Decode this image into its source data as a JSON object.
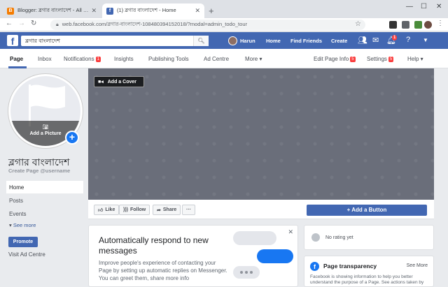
{
  "browser": {
    "tabs": [
      {
        "title": "Blogger: ব্লগার বাংলাদেশ - All po",
        "favicon_color": "#f57c00",
        "favicon_glyph": "B"
      },
      {
        "title": "(1) ব্লগার বাংলাদেশ - Home",
        "favicon_color": "#4267b2",
        "favicon_glyph": "f"
      }
    ],
    "new_tab": "+",
    "url": "web.facebook.com/ব্লগার-বাংলাদেশ-108480394152018/?modal=admin_todo_tour"
  },
  "fb_header": {
    "search_value": "ব্লগার বাংলাদেশ",
    "user": "Harun",
    "nav": [
      "Home",
      "Find Friends",
      "Create"
    ],
    "notification_count": "1"
  },
  "page_nav": {
    "left": [
      {
        "label": "Page"
      },
      {
        "label": "Inbox"
      },
      {
        "label": "Notifications",
        "badge": "1"
      },
      {
        "label": "Insights"
      },
      {
        "label": "Publishing Tools"
      },
      {
        "label": "Ad Centre"
      },
      {
        "label": "More ▾"
      }
    ],
    "right": [
      {
        "label": "Edit Page Info",
        "badge": "5"
      },
      {
        "label": "Settings",
        "badge": "5"
      },
      {
        "label": "Help ▾"
      }
    ]
  },
  "sidebar": {
    "add_picture": "Add a Picture",
    "page_name": "ব্লগার বাংলাদেশ",
    "username": "Create Page @username",
    "items": [
      "Home",
      "Posts",
      "Events"
    ],
    "see_more": "See more",
    "promote": "Promote",
    "visit_ad_centre": "Visit Ad Centre"
  },
  "cover": {
    "add_cover": "Add a Cover"
  },
  "actions": {
    "like": "Like",
    "follow": "Follow",
    "share": "Share",
    "more": "···",
    "add_button": "+ Add a Button"
  },
  "auto_respond": {
    "heading": "Automatically respond to new messages",
    "body": "Improve people's experience of contacting your Page by setting up automatic replies on Messenger. You can greet them, share more info"
  },
  "rating": {
    "text": "No rating yet"
  },
  "transparency": {
    "title": "Page transparency",
    "see_more": "See More",
    "desc": "Facebook is showing information to help you better understand the purpose of a Page. See actions taken by"
  },
  "colors": {
    "fb_blue": "#4267b2",
    "accent_blue": "#1877f2",
    "badge_red": "#fa3e3e"
  }
}
